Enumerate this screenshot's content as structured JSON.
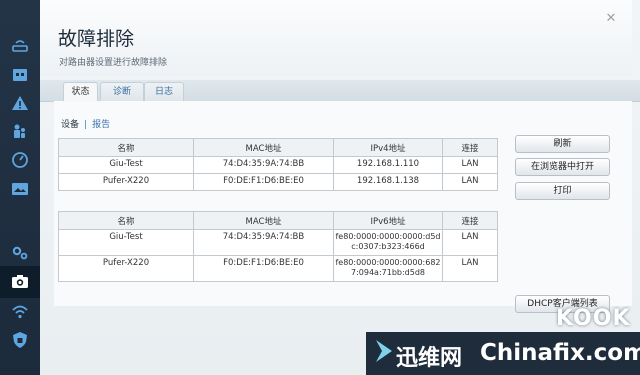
{
  "header": {
    "title": "故障排除",
    "subtitle": "对路由器设置进行故障排除"
  },
  "tabs": [
    {
      "label": "状态",
      "active": true
    },
    {
      "label": "诊断",
      "active": false
    },
    {
      "label": "日志",
      "active": false
    }
  ],
  "links": {
    "devices": "设备",
    "separator": "|",
    "report": "报告"
  },
  "ipv4_table": {
    "headers": [
      "名称",
      "MAC地址",
      "IPv4地址",
      "连接"
    ],
    "rows": [
      [
        "Giu-Test",
        "74:D4:35:9A:74:BB",
        "192.168.1.110",
        "LAN"
      ],
      [
        "Pufer-X220",
        "F0:DE:F1:D6:BE:E0",
        "192.168.1.138",
        "LAN"
      ]
    ]
  },
  "ipv6_table": {
    "headers": [
      "名称",
      "MAC地址",
      "IPv6地址",
      "连接"
    ],
    "rows": [
      [
        "Giu-Test",
        "74:D4:35:9A:74:BB",
        "fe80:0000:0000:0000:d5dc:0307:b323:466d",
        "LAN"
      ],
      [
        "Pufer-X220",
        "F0:DE:F1:D6:BE:E0",
        "fe80:0000:0000:0000:6827:094a:71bb:d5d8",
        "LAN"
      ]
    ]
  },
  "buttons": {
    "refresh": "刷新",
    "open_in_browser": "在浏览器中打开",
    "print": "打印",
    "dhcp_client_table": "DHCP客户端列表"
  },
  "sidebar_icons": [
    "router-icon",
    "calendar-icon",
    "warning-icon",
    "parental-icon",
    "gauge-icon",
    "media-icon",
    "settings-icon",
    "camera-icon",
    "wifi-icon",
    "shield-icon"
  ],
  "watermark": {
    "cn_text": "迅维网",
    "en_text": "Chinafix.com",
    "logo": "KOOK"
  },
  "colors": {
    "sidebar": "#1c2b3b",
    "link": "#3a74aa",
    "panel": "#eef2f5"
  }
}
